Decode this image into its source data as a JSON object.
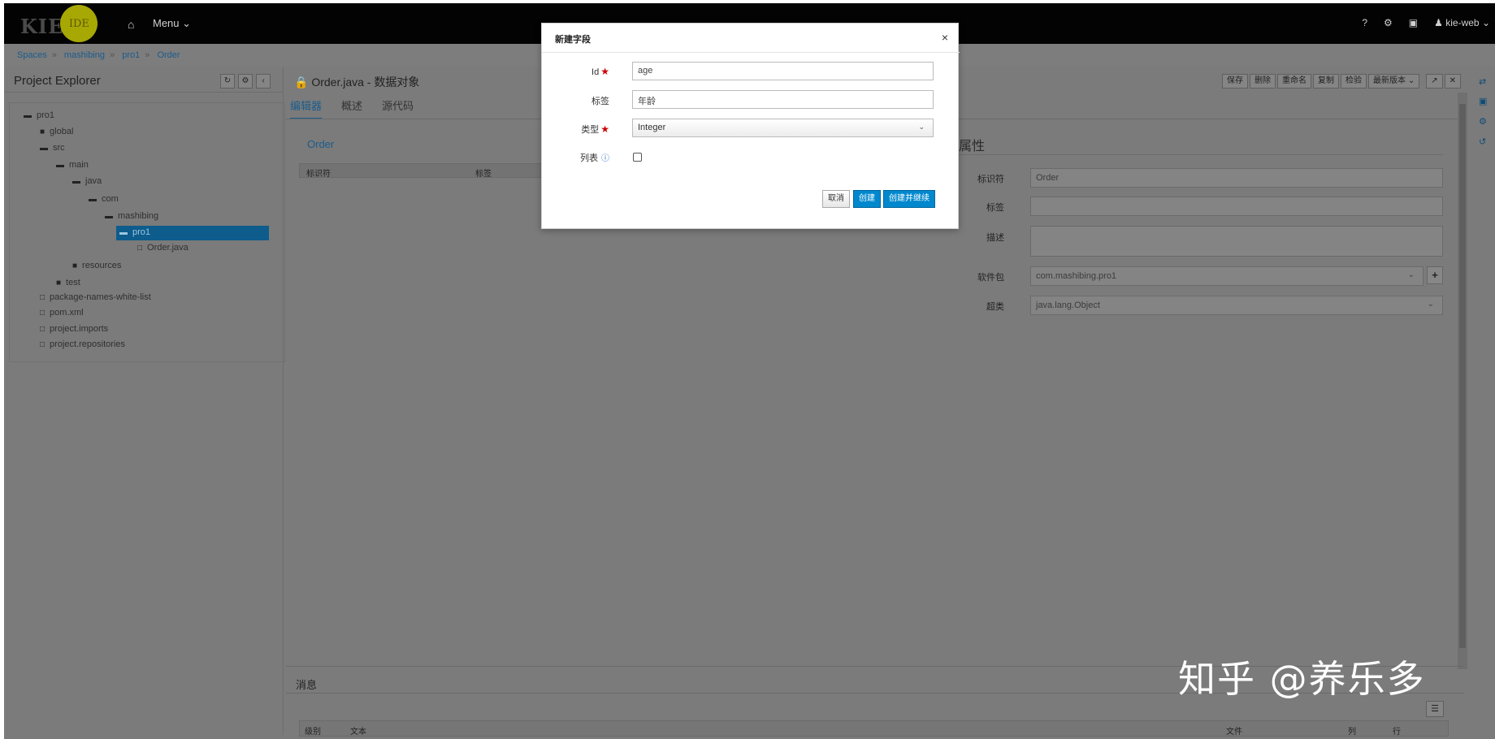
{
  "topbar": {
    "logo_kie": "KIE",
    "logo_ide": "IDE",
    "menu_label": "Menu",
    "help": "?",
    "user": "kie-web"
  },
  "breadcrumb": [
    "Spaces",
    "mashibing",
    "pro1",
    "Order"
  ],
  "left": {
    "title": "Project Explorer",
    "tree": [
      {
        "label": "pro1",
        "icon": "folder-open-icon"
      },
      {
        "label": "global",
        "icon": "folder-icon"
      },
      {
        "label": "src",
        "icon": "folder-open-icon"
      },
      {
        "label": "main",
        "icon": "folder-open-icon"
      },
      {
        "label": "java",
        "icon": "folder-open-icon"
      },
      {
        "label": "com",
        "icon": "folder-open-icon"
      },
      {
        "label": "mashibing",
        "icon": "folder-open-icon"
      },
      {
        "label": "pro1",
        "icon": "folder-open-icon",
        "selected": true
      },
      {
        "label": "Order.java",
        "icon": "file-icon"
      },
      {
        "label": "resources",
        "icon": "folder-icon"
      },
      {
        "label": "test",
        "icon": "folder-icon"
      },
      {
        "label": "package-names-white-list",
        "icon": "file-icon"
      },
      {
        "label": "pom.xml",
        "icon": "file-icon"
      },
      {
        "label": "project.imports",
        "icon": "file-icon"
      },
      {
        "label": "project.repositories",
        "icon": "file-icon"
      }
    ]
  },
  "editor": {
    "title": "Order.java - 数据对象",
    "tabs": [
      "编辑器",
      "概述",
      "源代码"
    ],
    "object_label": "Order",
    "table_headers": [
      "标识符",
      "标签"
    ],
    "toolbar": [
      "保存",
      "删除",
      "重命名",
      "复制",
      "检验",
      "最新版本"
    ]
  },
  "properties": {
    "title": "属性",
    "identifier_label": "标识符",
    "identifier_value": "Order",
    "label_label": "标签",
    "label_value": "",
    "desc_label": "描述",
    "desc_value": "",
    "package_label": "软件包",
    "package_value": "com.mashibing.pro1",
    "superclass_label": "超类",
    "superclass_value": "java.lang.Object"
  },
  "messages": {
    "title": "消息",
    "headers": [
      "级别",
      "文本",
      "文件",
      "列",
      "行"
    ]
  },
  "watermark": "知乎 @养乐多",
  "modal": {
    "title": "新建字段",
    "id_label": "Id",
    "id_value": "age",
    "label_label": "标签",
    "label_value": "年龄",
    "type_label": "类型",
    "type_value": "Integer",
    "list_label": "列表",
    "cancel": "取消",
    "create": "创建",
    "create_continue": "创建并继续"
  }
}
